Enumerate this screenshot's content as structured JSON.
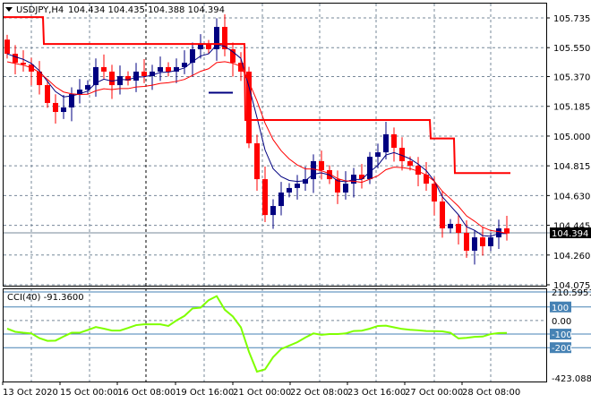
{
  "header": {
    "symbol": "USDJPY,H4",
    "ohlc": "104.434 104.435 104.388 104.394"
  },
  "indicator": {
    "label": "CCI(40) -91.3600"
  },
  "colors": {
    "bull": "#000080",
    "bear": "#ff0000",
    "ma_fast": "#000080",
    "ma_slow": "#ff0000",
    "stop": "#ff0000",
    "cci": "#7fff00",
    "level": "#4682b4",
    "grid": "#778899"
  },
  "chart_data": {
    "type": "candlestick",
    "title": "USDJPY,H4",
    "price_axis": {
      "min": 104.075,
      "max": 105.735,
      "ticks": [
        "105.735",
        "105.550",
        "105.370",
        "105.185",
        "105.000",
        "104.815",
        "104.630",
        "104.445",
        "104.260",
        "104.075"
      ]
    },
    "current_price": "104.394",
    "time_ticks": [
      "13 Oct 2020",
      "15 Oct 00:00",
      "16 Oct 08:00",
      "19 Oct 16:00",
      "21 Oct 00:00",
      "22 Oct 08:00",
      "23 Oct 16:00",
      "27 Oct 00:00",
      "28 Oct 08:00"
    ],
    "first_open": 105.6,
    "closes": [
      105.512,
      105.456,
      105.445,
      105.401,
      105.317,
      105.206,
      105.15,
      105.178,
      105.261,
      105.289,
      105.317,
      105.429,
      105.401,
      105.317,
      105.373,
      105.345,
      105.401,
      105.373,
      105.401,
      105.429,
      105.401,
      105.429,
      105.456,
      105.54,
      105.568,
      105.54,
      105.679,
      105.54,
      105.456,
      105.401,
      104.955,
      104.732,
      104.509,
      104.565,
      104.649,
      104.677,
      104.704,
      104.732,
      104.844,
      104.788,
      104.732,
      104.649,
      104.704,
      104.76,
      104.732,
      104.871,
      104.899,
      105.011,
      104.927,
      104.844,
      104.816,
      104.76,
      104.704,
      104.593,
      104.426,
      104.454,
      104.398,
      104.287,
      104.37,
      104.315,
      104.37,
      104.426,
      104.394
    ],
    "stop_line": [
      {
        "from": 0,
        "to": 4,
        "price": 105.74
      },
      {
        "from": 5,
        "to": 29,
        "price": 105.573
      },
      {
        "from": 30,
        "to": 52,
        "price": 105.1
      },
      {
        "from": 53,
        "to": 55,
        "price": 104.985
      },
      {
        "from": 56,
        "to": 62,
        "price": 104.77
      }
    ],
    "blue_segment": {
      "from": 25,
      "to": 28,
      "price": 105.27
    },
    "cci": {
      "label": "CCI(40)",
      "last": -91.36,
      "axis": {
        "max": 210.5951,
        "min": -423.0888,
        "ticks": [
          "210.5951",
          "100",
          "0.00",
          "-100",
          "-200",
          "-423.0888"
        ]
      },
      "levels": [
        100,
        -100,
        -200
      ],
      "values": [
        -60,
        -83,
        -90,
        -95,
        -130,
        -150,
        -148,
        -118,
        -90,
        -90,
        -70,
        -48,
        -60,
        -74,
        -74,
        -55,
        -34,
        -28,
        -28,
        -28,
        -40,
        0,
        34,
        89,
        95,
        150,
        180,
        80,
        30,
        -50,
        -230,
        -377,
        -360,
        -270,
        -210,
        -185,
        -160,
        -125,
        -95,
        -105,
        -100,
        -100,
        -95,
        -77,
        -75,
        -60,
        -40,
        -38,
        -50,
        -62,
        -68,
        -72,
        -77,
        -78,
        -80,
        -90,
        -132,
        -128,
        -120,
        -118,
        -100,
        -92,
        -91.36
      ]
    }
  }
}
